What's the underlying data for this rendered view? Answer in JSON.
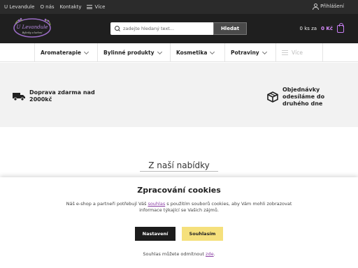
{
  "topbar": {
    "nav": [
      "U Levandule",
      "O nás",
      "Kontakty"
    ],
    "more_label": "Více",
    "login_label": "Přihlášení"
  },
  "header": {
    "logo_text": "U Levandule",
    "logo_tagline": "Bylinky a koření",
    "search_placeholder": "zadejte hledaný text...",
    "search_button": "Hledat",
    "cart_count": "0 ks za",
    "cart_price": "0 Kč",
    "accent_color": "#c97ff5"
  },
  "categories": [
    "Aromaterapie",
    "Bylinné produkty",
    "Kosmetika",
    "Potraviny"
  ],
  "categories_more": "Více",
  "banner": {
    "benefit_left": "Doprava zdarma nad 2000kč",
    "benefit_right": "Objednávky odesíláme do druhého dne"
  },
  "offer_heading": "Z naší nabídky",
  "cookie": {
    "title": "Zpracování cookies",
    "text_before": "Náš e-shop a partneři potřebují Váš ",
    "link": "souhlas",
    "text_after": " s použitím souborů cookies, aby Vám mohli zobrazovat informace týkající se Vašich zájmů.",
    "settings_button": "Nastavení",
    "agree_button": "Souhlasím",
    "revoke_before": "Souhlas můžete odmítnout ",
    "revoke_link": "zde",
    "revoke_after": "."
  }
}
